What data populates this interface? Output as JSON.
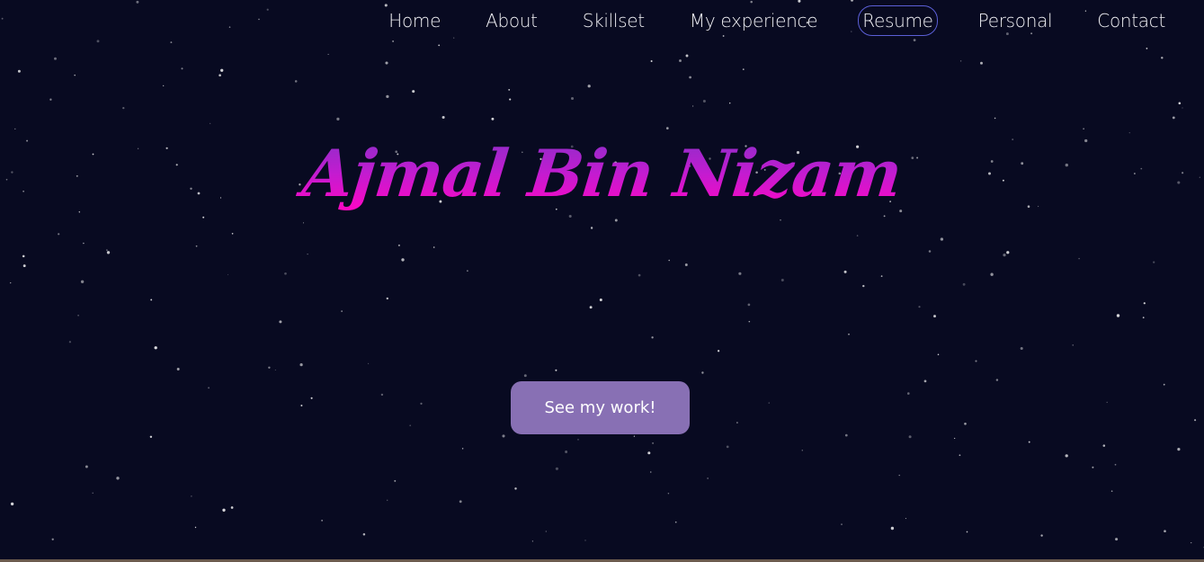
{
  "nav": {
    "items": [
      {
        "label": "Home",
        "active": false
      },
      {
        "label": "About",
        "active": false
      },
      {
        "label": "Skillset",
        "active": false
      },
      {
        "label": "My experience",
        "active": false
      },
      {
        "label": "Resume",
        "active": true
      },
      {
        "label": "Personal",
        "active": false
      },
      {
        "label": "Contact",
        "active": false
      }
    ]
  },
  "hero": {
    "name": "Ajmal Bin Nizam",
    "cta_label": "See my work!"
  },
  "colors": {
    "background": "#080a21",
    "accent_button": "#8870b4",
    "title_gradient_top": "#8a2fc8",
    "title_gradient_bottom": "#ff06c4",
    "active_nav_border": "#5b5fd6"
  }
}
